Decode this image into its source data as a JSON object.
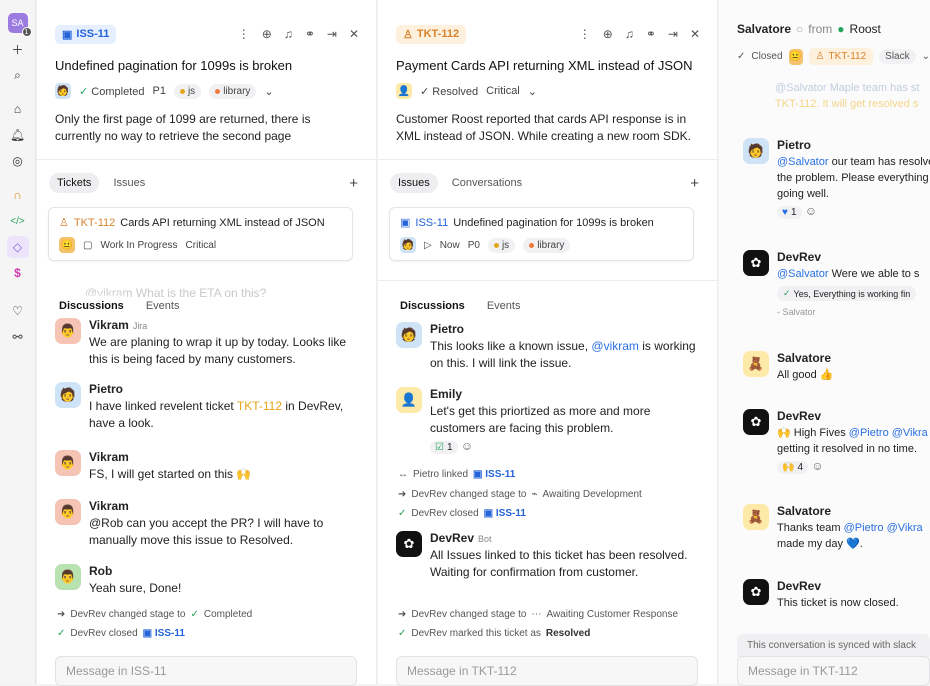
{
  "rail": {
    "avatar": "SA",
    "badge": "1"
  },
  "p1": {
    "id": "ISS-11",
    "title": "Undefined pagination for 1099s is broken",
    "status": "Completed",
    "priority": "P1",
    "tags": [
      "js",
      "library"
    ],
    "desc": "Only the first page of 1099 are returned, there is currently no way to retrieve the second page",
    "tabs": [
      "Tickets",
      "Issues"
    ],
    "card": {
      "id": "TKT-112",
      "title": "Cards API returning XML instead of JSON",
      "stage": "Work In Progress",
      "severity": "Critical"
    },
    "ghost": "@vikram What is the ETA on this?",
    "dtabs": [
      "Discussions",
      "Events"
    ],
    "msgs": [
      {
        "name": "Vikram",
        "sub": "Jira",
        "text": "We are planing to wrap it up by today. Looks like this is being faced by many customers."
      },
      {
        "name": "Pietro",
        "text_a": "I have linked revelent ticket ",
        "link": "TKT-112",
        "text_b": " in DevRev, have a look."
      },
      {
        "name": "Vikram",
        "text": "FS, I will get started on this 🙌"
      },
      {
        "name": "Vikram",
        "text": "@Rob can you accept the PR? I will have to manually move this issue to Resolved."
      },
      {
        "name": "Rob",
        "text": "Yeah sure, Done!"
      }
    ],
    "act1": "DevRev changed stage to",
    "act1v": "Completed",
    "act2": "DevRev closed",
    "act2v": "ISS-11",
    "placeholder": "Message in ISS-11"
  },
  "p2": {
    "id": "TKT-112",
    "title": "Payment Cards API returning XML instead of JSON",
    "status": "Resolved",
    "severity": "Critical",
    "desc": "Customer Roost reported that cards API response is in XML instead of JSON. While creating a new room SDK.",
    "tabs": [
      "Issues",
      "Conversations"
    ],
    "card": {
      "id": "ISS-11",
      "title": "Undefined pagination for 1099s is broken",
      "stage": "Now",
      "priority": "P0",
      "tags": [
        "js",
        "library"
      ]
    },
    "dtabs": [
      "Discussions",
      "Events"
    ],
    "m1": {
      "name": "Pietro",
      "text_a": "This looks like a known issue, ",
      "mention": "@vikram",
      "text_b": " is working on this. I will link the issue."
    },
    "m2": {
      "name": "Emily",
      "text": "Let's get this priortized as more and more customers are facing this problem.",
      "react": "1"
    },
    "a1": "Pietro linked",
    "a1v": "ISS-11",
    "a2": "DevRev changed stage to",
    "a2v": "Awaiting Development",
    "a3": "DevRev closed",
    "a3v": "ISS-11",
    "m3": {
      "name": "DevRev",
      "sub": "Bot",
      "text": "All Issues linked to this ticket has been resolved. Waiting for confirmation from customer."
    },
    "a4": "DevRev changed stage to",
    "a4v": "Awaiting Customer Response",
    "a5": "DevRev marked this ticket as",
    "a5v": "Resolved",
    "placeholder": "Message in TKT-112"
  },
  "p3": {
    "name": "Salvatore",
    "from": "from",
    "org": "Roost",
    "status": "Closed",
    "ticket": "TKT-112",
    "source": "Slack",
    "ghost_a": "@Salvator Maple team has st",
    "ghost_b": "TKT-112. It will get resolved s",
    "m1": {
      "name": "Pietro",
      "mention": "@Salvator",
      "text": " our team has resolved the problem. Please everything going well.",
      "react": "1"
    },
    "m2": {
      "name": "DevRev",
      "mention": "@Salvator",
      "text": " Were we able to s",
      "quote": "Yes, Everything is working fin",
      "by": "- Salvator"
    },
    "m3": {
      "name": "Salvatore",
      "text": "All good 👍"
    },
    "m4": {
      "name": "DevRev",
      "text_a": "🙌 High Fives ",
      "mention": "@Pietro @Vikra",
      "text_b": "getting it resolved in no time.",
      "react": "4"
    },
    "m5": {
      "name": "Salvatore",
      "text_a": "Thanks team ",
      "mention": "@Pietro @Vikra",
      "text_b": "made my day 💙."
    },
    "m6": {
      "name": "DevRev",
      "text": "This ticket is now closed."
    },
    "sync": "This conversation is synced with slack",
    "placeholder": "Message in TKT-112"
  }
}
